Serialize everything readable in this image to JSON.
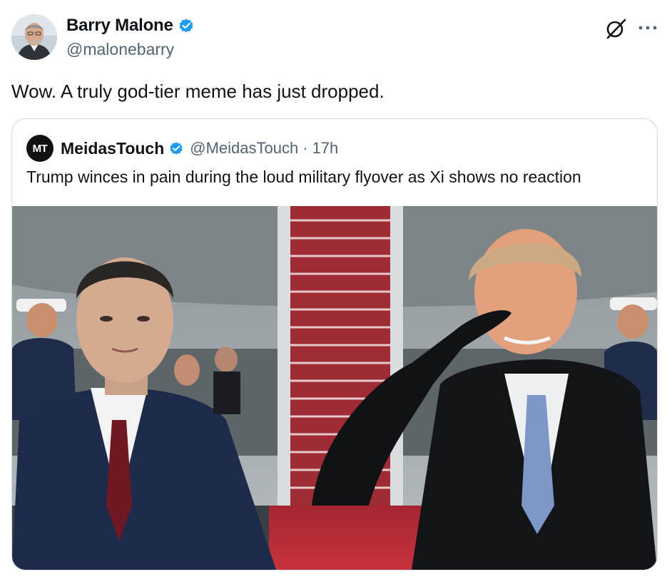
{
  "author": {
    "display_name": "Barry Malone",
    "handle": "@malonebarry",
    "verified": true
  },
  "tweet": {
    "text": "Wow. A truly god-tier meme has just dropped."
  },
  "quoted": {
    "logo_text": "MT",
    "display_name": "MeidasTouch",
    "handle": "@MeidasTouch",
    "separator": "·",
    "time": "17h",
    "text": "Trump winces in pain during the loud military flyover as Xi shows no reaction",
    "media": "photo of two leaders in dark suits standing before an aircraft stairway with red carpet; one on the right saluting"
  },
  "icons": {
    "grok": "grok-icon",
    "more": "more-icon",
    "verified": "verified-badge-icon"
  },
  "colors": {
    "verified": "#1d9bf0",
    "secondary_text": "#536471",
    "border": "#cfd9de"
  }
}
